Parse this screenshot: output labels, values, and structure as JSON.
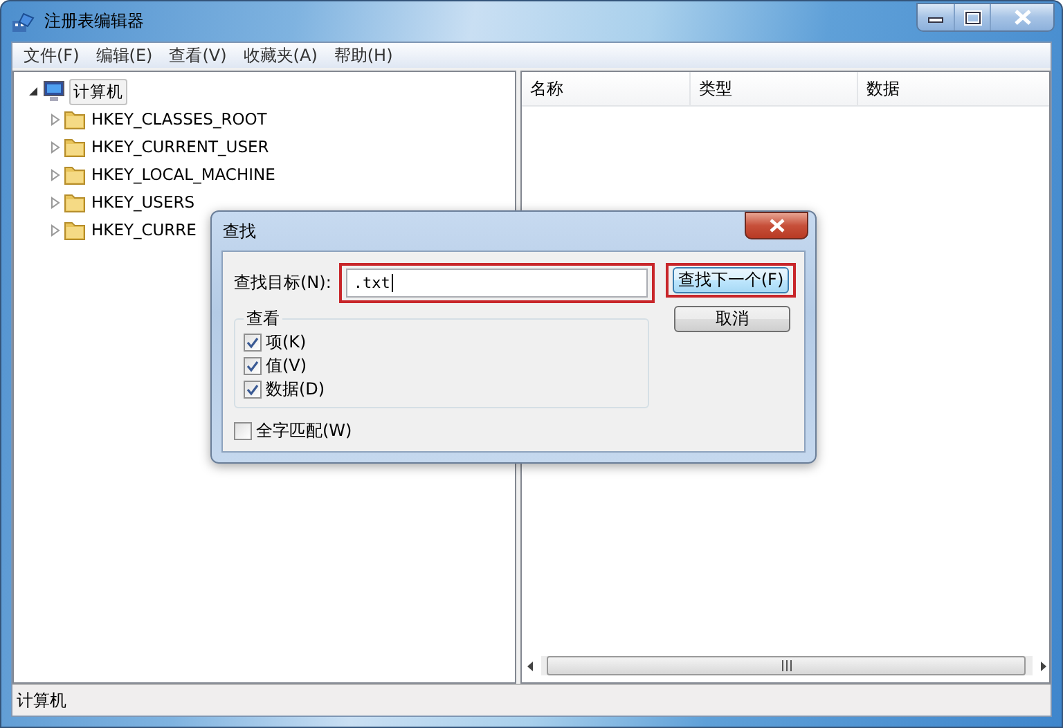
{
  "window": {
    "title": "注册表编辑器"
  },
  "menu": [
    "文件(F)",
    "编辑(E)",
    "查看(V)",
    "收藏夹(A)",
    "帮助(H)"
  ],
  "tree": {
    "label": "计算机",
    "expanded": true,
    "selected": true,
    "children": [
      {
        "label": "HKEY_CLASSES_ROOT",
        "expanded": false
      },
      {
        "label": "HKEY_CURRENT_USER",
        "expanded": false
      },
      {
        "label": "HKEY_LOCAL_MACHINE",
        "expanded": false
      },
      {
        "label": "HKEY_USERS",
        "expanded": false
      },
      {
        "label": "HKEY_CURRE",
        "expanded": false
      }
    ]
  },
  "list": {
    "columns": [
      "名称",
      "类型",
      "数据"
    ]
  },
  "status_bar": "计算机",
  "dialog": {
    "title": "查找",
    "find_label": "查找目标(N):",
    "find_value": ".txt",
    "find_highlighted": true,
    "buttons": [
      {
        "label": "查找下一个(F)",
        "default": true,
        "highlighted": true
      },
      {
        "label": "取消",
        "default": false,
        "highlighted": false
      }
    ],
    "group": "查看",
    "options": [
      {
        "label": "项(K)",
        "checked": true
      },
      {
        "label": "值(V)",
        "checked": true
      },
      {
        "label": "数据(D)",
        "checked": true
      }
    ],
    "whole_word": {
      "label": "全字匹配(W)",
      "checked": false
    }
  }
}
